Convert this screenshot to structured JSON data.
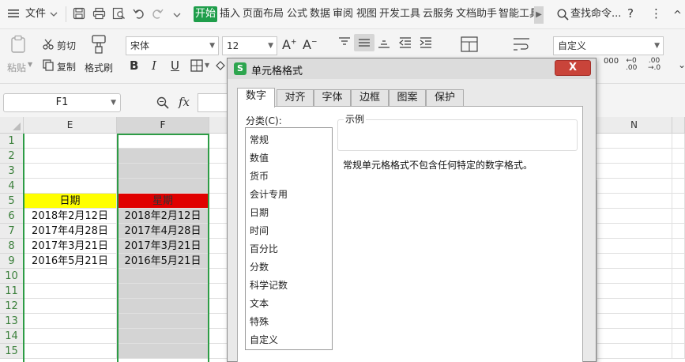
{
  "menubar": {
    "file": "文件",
    "tabs": [
      "插入",
      "页面布局",
      "公式",
      "数据",
      "审阅",
      "视图",
      "开发工具",
      "云服务",
      "文档助手",
      "智能工具"
    ],
    "active_tab": "开始",
    "search": "查找命令...",
    "help": "?",
    "more": "⋮",
    "collapse": "^"
  },
  "ribbon": {
    "paste": "粘贴",
    "cut": "剪切",
    "copy": "复制",
    "format_painter": "格式刷",
    "font_name": "宋体",
    "font_size": "12",
    "number_format": "自定义",
    "increase_font": "A⁺",
    "decrease_font": "A⁻",
    "bold": "B",
    "italic": "I",
    "underline": "U"
  },
  "formula_bar": {
    "name_box": "F1",
    "fx": "fx"
  },
  "sheet": {
    "columns": [
      "E",
      "F",
      "N"
    ],
    "rows": [
      "1",
      "2",
      "3",
      "4",
      "5",
      "6",
      "7",
      "8",
      "9",
      "10",
      "11",
      "12",
      "13",
      "14",
      "15"
    ],
    "header_e": "日期",
    "header_f": "星期",
    "dates_e": [
      "2018年2月12日",
      "2017年4月28日",
      "2017年3月21日",
      "2016年5月21日"
    ],
    "dates_f": [
      "2018年2月12日",
      "2017年4月28日",
      "2017年3月21日",
      "2016年5月21日"
    ]
  },
  "dialog": {
    "title": "单元格格式",
    "close": "X",
    "tabs": [
      "数字",
      "对齐",
      "字体",
      "边框",
      "图案",
      "保护"
    ],
    "category_label": "分类(C):",
    "categories": [
      "常规",
      "数值",
      "货币",
      "会计专用",
      "日期",
      "时间",
      "百分比",
      "分数",
      "科学记数",
      "文本",
      "特殊",
      "自定义"
    ],
    "sample_label": "示例",
    "description": "常规单元格格式不包含任何特定的数字格式。"
  },
  "colors": {
    "accent_green": "#1f9e4b",
    "header_yellow": "#ffff00",
    "header_red": "#e00000",
    "close_red": "#c9443a"
  }
}
